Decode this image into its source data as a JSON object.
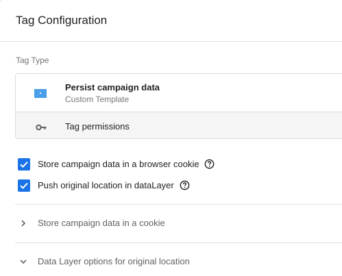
{
  "panel": {
    "title": "Tag Configuration"
  },
  "tag_type": {
    "section_label": "Tag Type",
    "name": "Persist campaign data",
    "subtitle": "Custom Template",
    "icon": "custom-template-icon",
    "icon_color": "#4a9eea",
    "permissions_label": "Tag permissions",
    "permissions_icon": "key-icon"
  },
  "options": [
    {
      "label": "Store campaign data in a browser cookie",
      "checked": true
    },
    {
      "label": "Push original location in dataLayer",
      "checked": true
    }
  ],
  "sections": [
    {
      "label": "Store campaign data in a cookie",
      "expanded": false
    },
    {
      "label": "Data Layer options for original location",
      "expanded": true
    }
  ],
  "colors": {
    "accent": "#1a73e8",
    "secondary_text": "#757575"
  }
}
